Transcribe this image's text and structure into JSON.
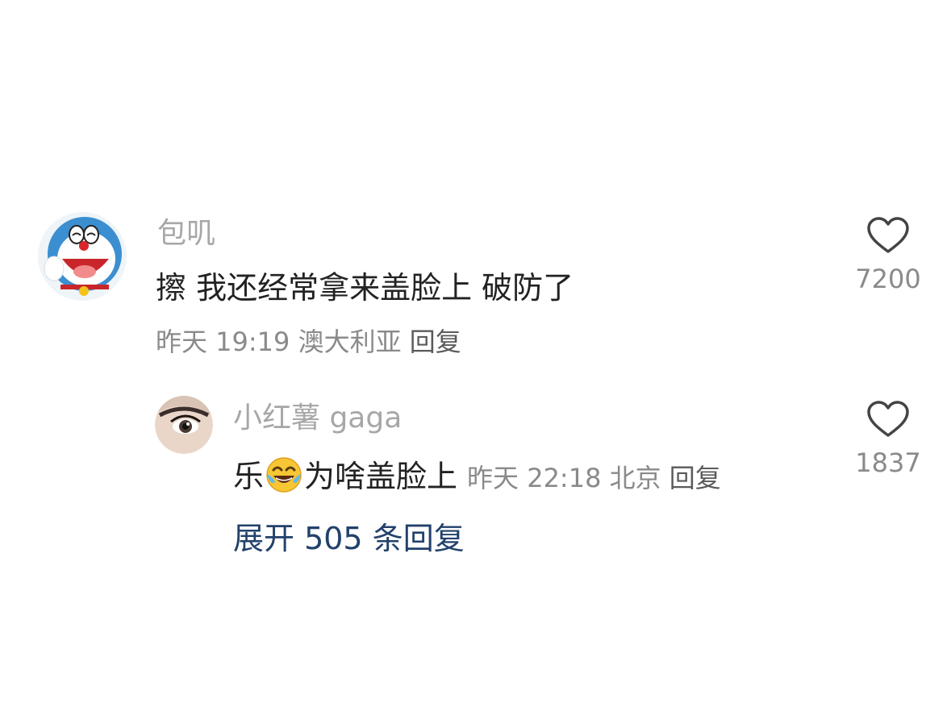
{
  "comment": {
    "username": "包叽",
    "text": "擦 我还经常拿来盖脸上 破防了",
    "time": "昨天 19:19",
    "location": "澳大利亚",
    "reply_label": "回复",
    "likes": "7200",
    "avatar_icon": "doraemon-avatar"
  },
  "reply": {
    "username": "小红薯 gaga",
    "text_before": "乐",
    "emoji": "face-with-tears-of-joy",
    "text_after": "为啥盖脸上",
    "time": "昨天 22:18",
    "location": "北京",
    "reply_label": "回复",
    "likes": "1837",
    "avatar_icon": "eye-closeup-avatar"
  },
  "expand_replies": "展开 505 条回复",
  "colors": {
    "username": "#a7a7a7",
    "text": "#222222",
    "meta": "#8a8a8a",
    "link": "#22416b"
  }
}
